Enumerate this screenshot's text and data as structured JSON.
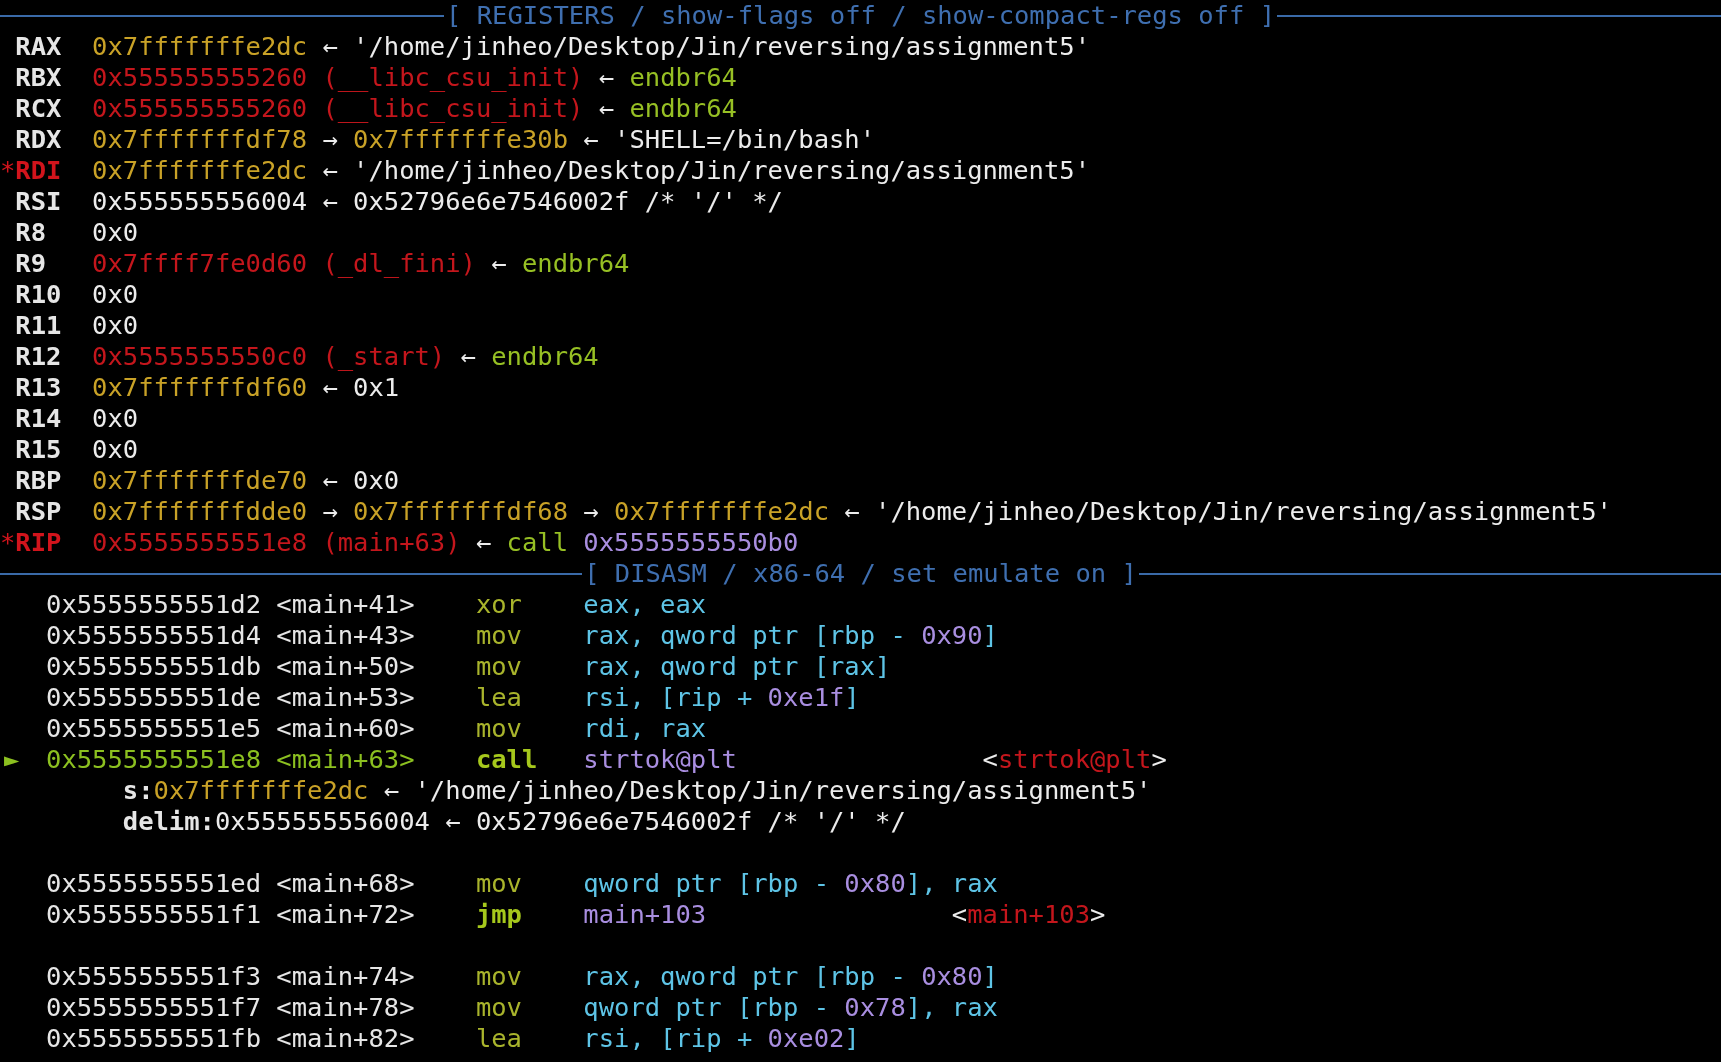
{
  "registers": {
    "title": "[ REGISTERS / show-flags off / show-compact-regs off ]",
    "rows": [
      {
        "name": "RAX",
        "changed": false,
        "chain": [
          {
            "text": "0x7fffffffe2dc",
            "kind": "stack"
          },
          {
            "text": "←",
            "kind": "arrow"
          },
          {
            "text": "'/home/jinheo/Desktop/Jin/reversing/assignment5'",
            "kind": "string"
          }
        ]
      },
      {
        "name": "RBX",
        "changed": false,
        "chain": [
          {
            "text": "0x555555555260",
            "kind": "code"
          },
          {
            "text": "(__libc_csu_init)",
            "kind": "symbol"
          },
          {
            "text": "←",
            "kind": "arrow"
          },
          {
            "text": "endbr64",
            "kind": "instr"
          }
        ]
      },
      {
        "name": "RCX",
        "changed": false,
        "chain": [
          {
            "text": "0x555555555260",
            "kind": "code"
          },
          {
            "text": "(__libc_csu_init)",
            "kind": "symbol"
          },
          {
            "text": "←",
            "kind": "arrow"
          },
          {
            "text": "endbr64",
            "kind": "instr"
          }
        ]
      },
      {
        "name": "RDX",
        "changed": false,
        "chain": [
          {
            "text": "0x7fffffffdf78",
            "kind": "stack"
          },
          {
            "text": "→",
            "kind": "arrow"
          },
          {
            "text": "0x7fffffffe30b",
            "kind": "stack"
          },
          {
            "text": "←",
            "kind": "arrow"
          },
          {
            "text": "'SHELL=/bin/bash'",
            "kind": "string"
          }
        ]
      },
      {
        "name": "RDI",
        "changed": true,
        "prefix": "*",
        "chain": [
          {
            "text": "0x7fffffffe2dc",
            "kind": "stack"
          },
          {
            "text": "←",
            "kind": "arrow"
          },
          {
            "text": "'/home/jinheo/Desktop/Jin/reversing/assignment5'",
            "kind": "string"
          }
        ]
      },
      {
        "name": "RSI",
        "changed": false,
        "chain": [
          {
            "text": "0x555555556004",
            "kind": "data"
          },
          {
            "text": "←",
            "kind": "arrow"
          },
          {
            "text": "0x52796e6e7546002f",
            "kind": "data"
          },
          {
            "text": "/* '/' */",
            "kind": "data"
          }
        ]
      },
      {
        "name": "R8",
        "changed": false,
        "chain": [
          {
            "text": "0x0",
            "kind": "data"
          }
        ]
      },
      {
        "name": "R9",
        "changed": false,
        "chain": [
          {
            "text": "0x7ffff7fe0d60",
            "kind": "code"
          },
          {
            "text": "(_dl_fini)",
            "kind": "symbol"
          },
          {
            "text": "←",
            "kind": "arrow"
          },
          {
            "text": "endbr64",
            "kind": "instr"
          }
        ]
      },
      {
        "name": "R10",
        "changed": false,
        "chain": [
          {
            "text": "0x0",
            "kind": "data"
          }
        ]
      },
      {
        "name": "R11",
        "changed": false,
        "chain": [
          {
            "text": "0x0",
            "kind": "data"
          }
        ]
      },
      {
        "name": "R12",
        "changed": false,
        "chain": [
          {
            "text": "0x5555555550c0",
            "kind": "code"
          },
          {
            "text": "(_start)",
            "kind": "symbol"
          },
          {
            "text": "←",
            "kind": "arrow"
          },
          {
            "text": "endbr64",
            "kind": "instr"
          }
        ]
      },
      {
        "name": "R13",
        "changed": false,
        "chain": [
          {
            "text": "0x7fffffffdf60",
            "kind": "stack"
          },
          {
            "text": "←",
            "kind": "arrow"
          },
          {
            "text": "0x1",
            "kind": "data"
          }
        ]
      },
      {
        "name": "R14",
        "changed": false,
        "chain": [
          {
            "text": "0x0",
            "kind": "data"
          }
        ]
      },
      {
        "name": "R15",
        "changed": false,
        "chain": [
          {
            "text": "0x0",
            "kind": "data"
          }
        ]
      },
      {
        "name": "RBP",
        "changed": false,
        "chain": [
          {
            "text": "0x7fffffffde70",
            "kind": "stack"
          },
          {
            "text": "←",
            "kind": "arrow"
          },
          {
            "text": "0x0",
            "kind": "data"
          }
        ]
      },
      {
        "name": "RSP",
        "changed": false,
        "chain": [
          {
            "text": "0x7fffffffdde0",
            "kind": "stack"
          },
          {
            "text": "→",
            "kind": "arrow"
          },
          {
            "text": "0x7fffffffdf68",
            "kind": "stack"
          },
          {
            "text": "→",
            "kind": "arrow"
          },
          {
            "text": "0x7fffffffe2dc",
            "kind": "stack"
          },
          {
            "text": "←",
            "kind": "arrow"
          },
          {
            "text": "'/home/jinheo/Desktop/Jin/reversing/assignment5'",
            "kind": "string"
          }
        ]
      },
      {
        "name": "RIP",
        "changed": true,
        "prefix": "*",
        "chain": [
          {
            "text": "0x5555555551e8",
            "kind": "code"
          },
          {
            "text": "(main+63)",
            "kind": "symbol"
          },
          {
            "text": "←",
            "kind": "arrow"
          },
          {
            "text": "call",
            "kind": "instr"
          },
          {
            "text": "0x5555555550b0",
            "kind": "target"
          }
        ]
      }
    ]
  },
  "disasm": {
    "title": "[ DISASM / x86-64 / set emulate on ]",
    "rows": [
      {
        "kind": "instruction",
        "current": false,
        "address": "0x5555555551d2",
        "offset": "<main+41>",
        "mnemonic": "xor",
        "branch": false,
        "operands": [
          {
            "text": "eax, eax",
            "kind": "reg"
          }
        ]
      },
      {
        "kind": "instruction",
        "current": false,
        "address": "0x5555555551d4",
        "offset": "<main+43>",
        "mnemonic": "mov",
        "branch": false,
        "operands": [
          {
            "text": "rax, qword ptr [rbp - ",
            "kind": "reg"
          },
          {
            "text": "0x90",
            "kind": "imm"
          },
          {
            "text": "]",
            "kind": "reg"
          }
        ]
      },
      {
        "kind": "instruction",
        "current": false,
        "address": "0x5555555551db",
        "offset": "<main+50>",
        "mnemonic": "mov",
        "branch": false,
        "operands": [
          {
            "text": "rax, qword ptr [rax]",
            "kind": "reg"
          }
        ]
      },
      {
        "kind": "instruction",
        "current": false,
        "address": "0x5555555551de",
        "offset": "<main+53>",
        "mnemonic": "lea",
        "branch": false,
        "operands": [
          {
            "text": "rsi, [rip + ",
            "kind": "reg"
          },
          {
            "text": "0xe1f",
            "kind": "imm"
          },
          {
            "text": "]",
            "kind": "reg"
          }
        ]
      },
      {
        "kind": "instruction",
        "current": false,
        "address": "0x5555555551e5",
        "offset": "<main+60>",
        "mnemonic": "mov",
        "branch": false,
        "operands": [
          {
            "text": "rdi, rax",
            "kind": "reg"
          }
        ]
      },
      {
        "kind": "instruction",
        "current": true,
        "marker": "►",
        "address": "0x5555555551e8",
        "offset": "<main+63>",
        "mnemonic": "call",
        "branch": true,
        "operands": [
          {
            "text": "strtok@plt",
            "kind": "imm"
          }
        ],
        "target": [
          {
            "text": "<",
            "kind": "punct"
          },
          {
            "text": "strtok@plt",
            "kind": "sym"
          },
          {
            "text": ">",
            "kind": "punct"
          }
        ]
      },
      {
        "kind": "argument",
        "label": "s:",
        "chain": [
          {
            "text": "0x7fffffffe2dc",
            "kind": "stack"
          },
          {
            "text": "←",
            "kind": "arrow"
          },
          {
            "text": "'/home/jinheo/Desktop/Jin/reversing/assignment5'",
            "kind": "string"
          }
        ]
      },
      {
        "kind": "argument",
        "label": "delim:",
        "chain": [
          {
            "text": "0x555555556004",
            "kind": "data"
          },
          {
            "text": "←",
            "kind": "arrow"
          },
          {
            "text": "0x52796e6e7546002f",
            "kind": "data"
          },
          {
            "text": "/* '/' */",
            "kind": "data"
          }
        ]
      },
      {
        "kind": "blank"
      },
      {
        "kind": "instruction",
        "current": false,
        "address": "0x5555555551ed",
        "offset": "<main+68>",
        "mnemonic": "mov",
        "branch": false,
        "operands": [
          {
            "text": "qword ptr [rbp - ",
            "kind": "reg"
          },
          {
            "text": "0x80",
            "kind": "imm"
          },
          {
            "text": "], rax",
            "kind": "reg"
          }
        ]
      },
      {
        "kind": "instruction",
        "current": false,
        "address": "0x5555555551f1",
        "offset": "<main+72>",
        "mnemonic": "jmp",
        "branch": true,
        "operands": [
          {
            "text": "main+103",
            "kind": "imm"
          }
        ],
        "target": [
          {
            "text": "<",
            "kind": "punct"
          },
          {
            "text": "main+103",
            "kind": "sym"
          },
          {
            "text": ">",
            "kind": "punct"
          }
        ]
      },
      {
        "kind": "blank"
      },
      {
        "kind": "instruction",
        "current": false,
        "address": "0x5555555551f3",
        "offset": "<main+74>",
        "mnemonic": "mov",
        "branch": false,
        "operands": [
          {
            "text": "rax, qword ptr [rbp - ",
            "kind": "reg"
          },
          {
            "text": "0x80",
            "kind": "imm"
          },
          {
            "text": "]",
            "kind": "reg"
          }
        ]
      },
      {
        "kind": "instruction",
        "current": false,
        "address": "0x5555555551f7",
        "offset": "<main+78>",
        "mnemonic": "mov",
        "branch": false,
        "operands": [
          {
            "text": "qword ptr [rbp - ",
            "kind": "reg"
          },
          {
            "text": "0x78",
            "kind": "imm"
          },
          {
            "text": "], rax",
            "kind": "reg"
          }
        ]
      },
      {
        "kind": "instruction",
        "current": false,
        "address": "0x5555555551fb",
        "offset": "<main+82>",
        "mnemonic": "lea",
        "branch": false,
        "operands": [
          {
            "text": "rsi, [rip + ",
            "kind": "reg"
          },
          {
            "text": "0xe02",
            "kind": "imm"
          },
          {
            "text": "]",
            "kind": "reg"
          }
        ]
      }
    ]
  }
}
